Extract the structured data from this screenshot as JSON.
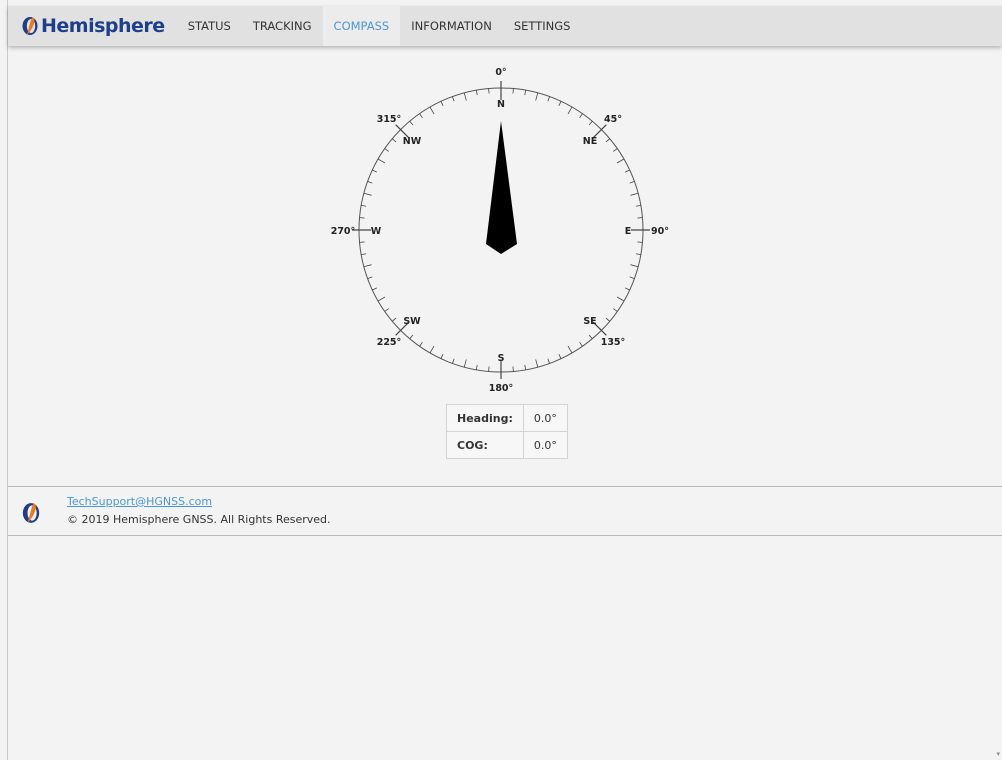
{
  "brand": {
    "name": "Hemisphere"
  },
  "nav": {
    "items": [
      {
        "label": "STATUS",
        "active": false
      },
      {
        "label": "TRACKING",
        "active": false
      },
      {
        "label": "COMPASS",
        "active": true
      },
      {
        "label": "INFORMATION",
        "active": false
      },
      {
        "label": "SETTINGS",
        "active": false
      }
    ]
  },
  "compass": {
    "heading_deg": 0,
    "degree_labels": {
      "d0": "0°",
      "d45": "45°",
      "d90": "90°",
      "d135": "135°",
      "d180": "180°",
      "d225": "225°",
      "d270": "270°",
      "d315": "315°"
    },
    "cardinal_labels": {
      "n": "N",
      "ne": "NE",
      "e": "E",
      "se": "SE",
      "s": "S",
      "sw": "SW",
      "w": "W",
      "nw": "NW"
    }
  },
  "readout": {
    "heading_label": "Heading:",
    "heading_value": "0.0°",
    "cog_label": "COG:",
    "cog_value": "0.0°"
  },
  "footer": {
    "email": "TechSupport@HGNSS.com",
    "copyright": "© 2019 Hemisphere GNSS. All Rights Reserved."
  },
  "colors": {
    "brand_blue": "#1d3f8a",
    "brand_orange": "#f0781e",
    "active_nav": "#4a97d2",
    "needle": "#000000"
  }
}
